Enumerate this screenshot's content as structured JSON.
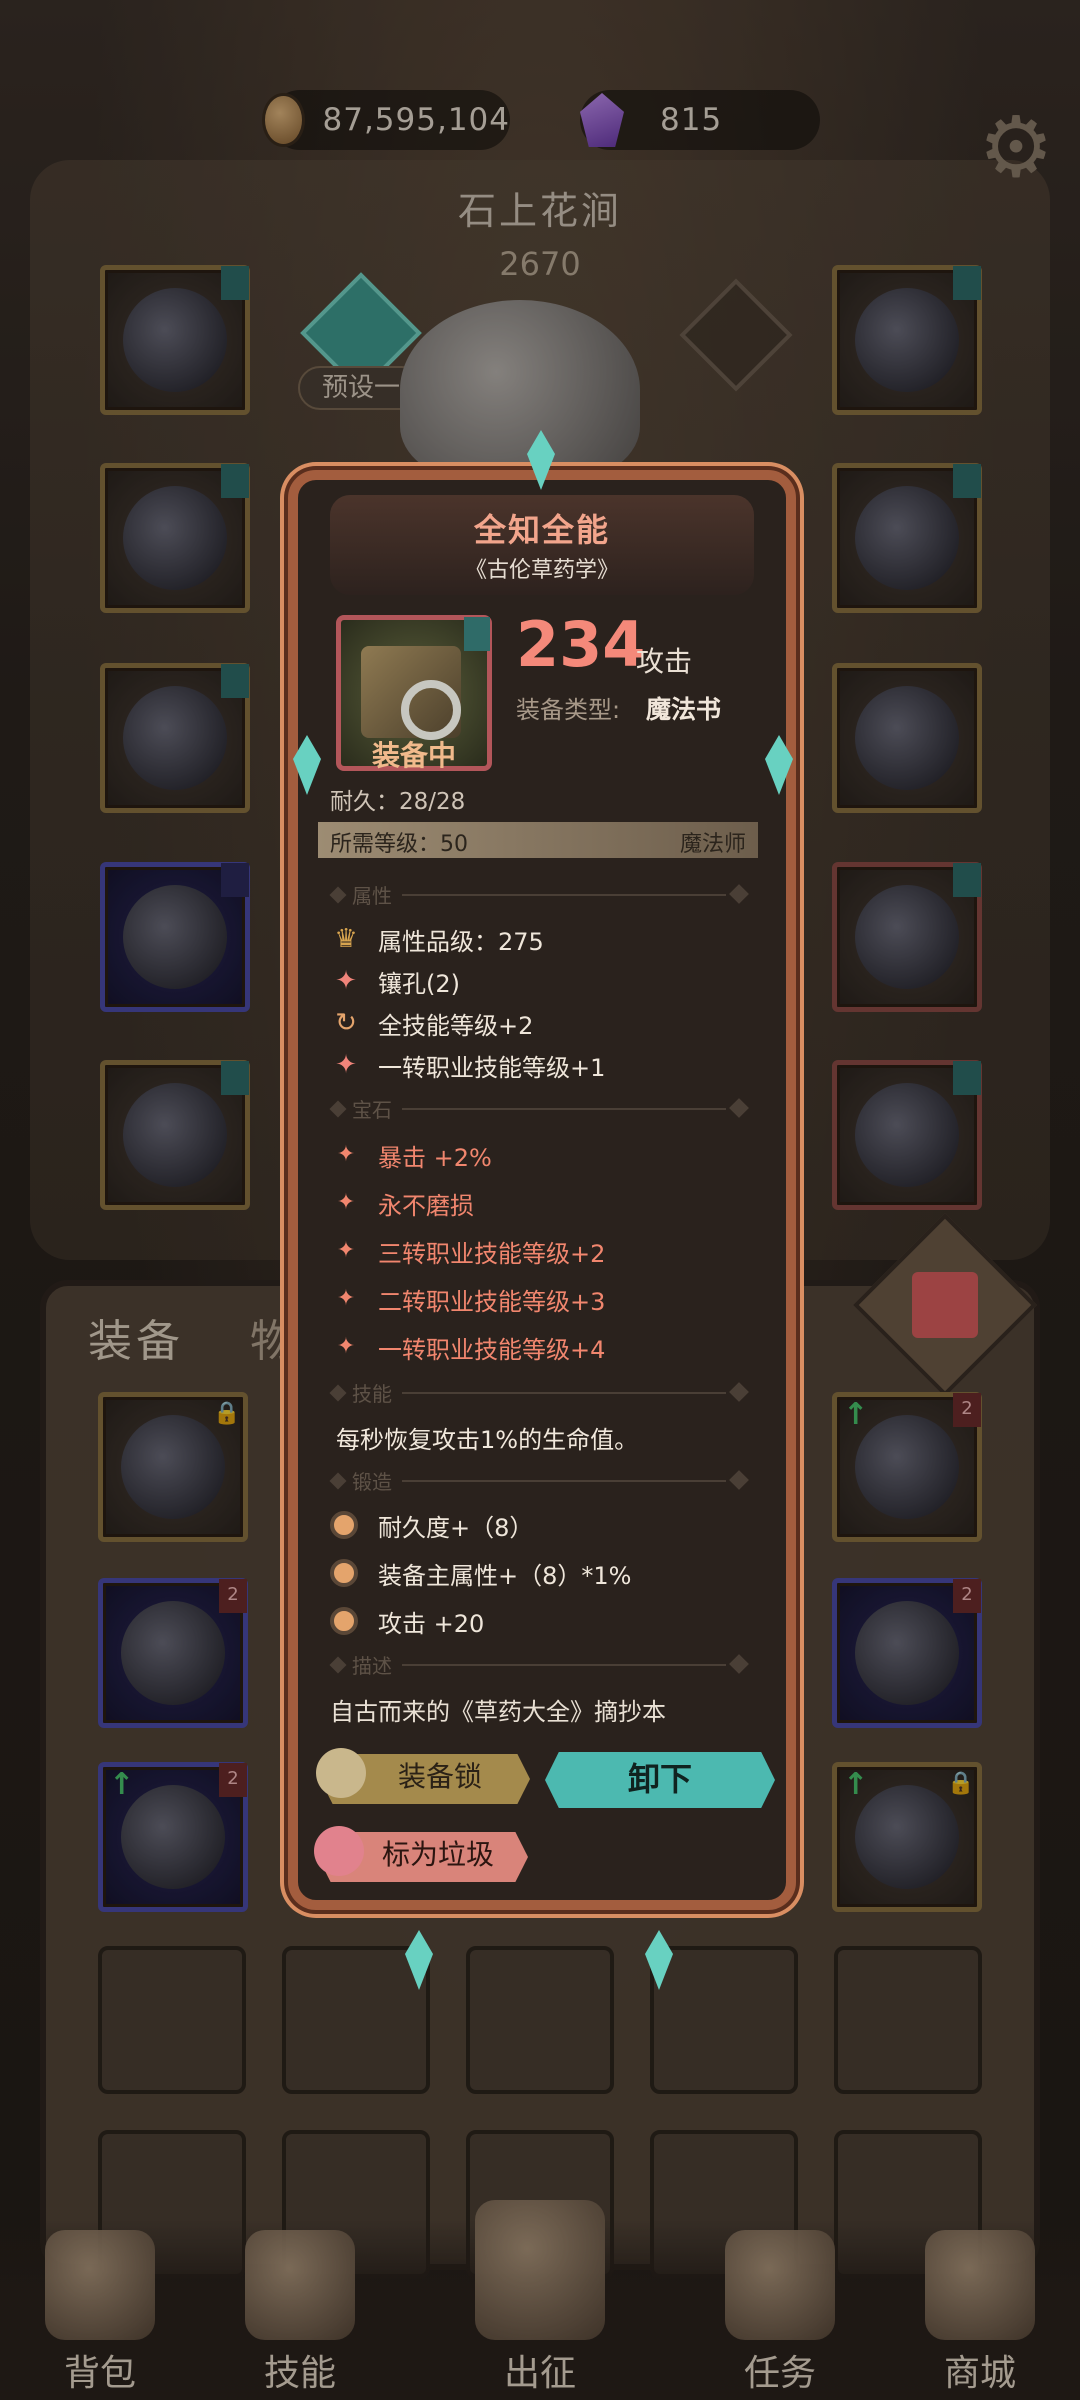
{
  "currency": {
    "gold": "87,595,104",
    "gems": "815",
    "gold_icon": "coin-icon",
    "gem_icon": "purple-gem-icon"
  },
  "area": {
    "name": "石上花涧",
    "level": "2670"
  },
  "preset": {
    "label": "预设一"
  },
  "bag_tabs": {
    "equipment": "装备",
    "items": "物品"
  },
  "nav": [
    {
      "label": "背包",
      "icon": "backpack-icon"
    },
    {
      "label": "技能",
      "icon": "skill-book-icon"
    },
    {
      "label": "出征",
      "icon": "sword-icon"
    },
    {
      "label": "任务",
      "icon": "scroll-icon"
    },
    {
      "label": "商城",
      "icon": "shop-icon"
    }
  ],
  "tooltip": {
    "title": "全知全能",
    "subtitle": "《古伦草药学》",
    "equipped": "装备中",
    "attack_value": "234",
    "attack_label": "攻击",
    "type_label": "装备类型:",
    "type_value": "魔法书",
    "durability": "耐久：28/28",
    "req_level": "所需等级：50",
    "req_class": "魔法师",
    "sections": {
      "attr": "属性",
      "gem": "宝石",
      "skill": "技能",
      "forge": "锻造",
      "desc": "描述"
    },
    "attrs": [
      "属性品级：275",
      "镶孔(2)",
      "全技能等级+2",
      "一转职业技能等级+1"
    ],
    "gems": [
      "暴击 +2%",
      "永不磨损",
      "三转职业技能等级+2",
      "二转职业技能等级+3",
      "一转职业技能等级+4"
    ],
    "skill": "每秒恢复攻击1%的生命值。",
    "forge": [
      "耐久度+（8）",
      "装备主属性+（8）*1%",
      "攻击 +20"
    ],
    "desc": "自古而来的《草药大全》摘抄本",
    "buttons": {
      "lock": "装备锁",
      "unequip": "卸下",
      "junk": "标为垃圾"
    }
  },
  "colors": {
    "accent_red": "#f4897a",
    "teal": "#4cb9b0",
    "gold": "#a48a4c"
  }
}
